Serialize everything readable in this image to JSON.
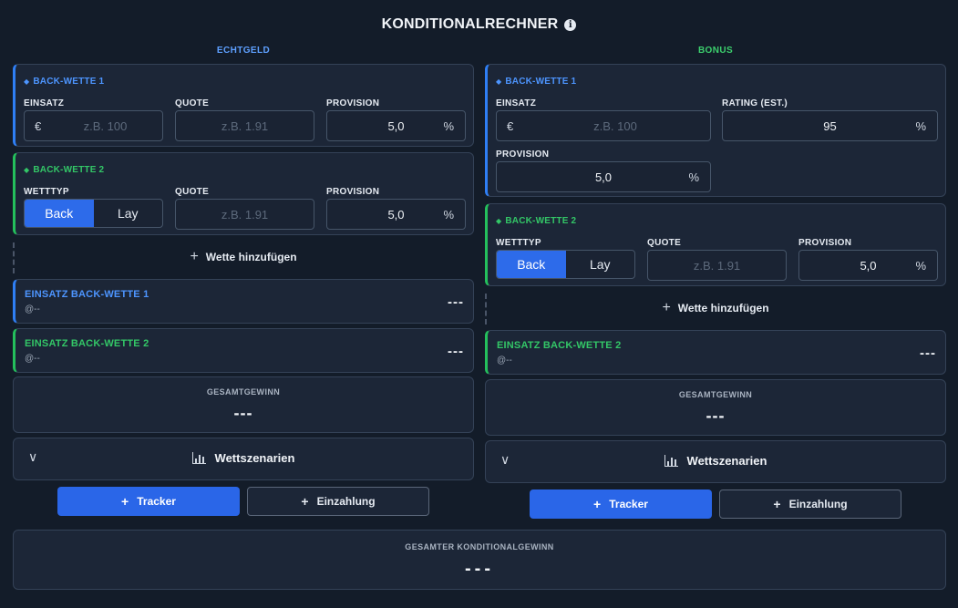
{
  "title": "KONDITIONALRECHNER",
  "info_icon": "info-icon",
  "left": {
    "header": "ECHTGELD",
    "bet1": {
      "title": "BACK-WETTE 1",
      "stake_label": "EINSATZ",
      "stake_prefix": "€",
      "stake_placeholder": "z.B. 100",
      "odds_label": "QUOTE",
      "odds_placeholder": "z.B. 1.91",
      "commission_label": "PROVISION",
      "commission_value": "5,0",
      "commission_suffix": "%"
    },
    "bet2": {
      "title": "BACK-WETTE 2",
      "type_label": "WETTTYP",
      "type_options": [
        "Back",
        "Lay"
      ],
      "type_selected": "Back",
      "odds_label": "QUOTE",
      "odds_placeholder": "z.B. 1.91",
      "commission_label": "PROVISION",
      "commission_value": "5,0",
      "commission_suffix": "%"
    },
    "add_bet": "Wette hinzufügen",
    "stakes": [
      {
        "title": "EINSATZ BACK-WETTE 1",
        "sub": "@--",
        "value": "---"
      },
      {
        "title": "EINSATZ BACK-WETTE 2",
        "sub": "@--",
        "value": "---"
      }
    ],
    "total_label": "GESAMTGEWINN",
    "total_value": "---",
    "scenarios_label": "Wettszenarien",
    "tracker_label": "Tracker",
    "deposit_label": "Einzahlung"
  },
  "right": {
    "header": "BONUS",
    "bet1": {
      "title": "BACK-WETTE 1",
      "stake_label": "EINSATZ",
      "stake_prefix": "€",
      "stake_placeholder": "z.B. 100",
      "rating_label": "RATING (EST.)",
      "rating_value": "95",
      "rating_suffix": "%",
      "commission_label": "PROVISION",
      "commission_value": "5,0",
      "commission_suffix": "%"
    },
    "bet2": {
      "title": "BACK-WETTE 2",
      "type_label": "WETTTYP",
      "type_options": [
        "Back",
        "Lay"
      ],
      "type_selected": "Back",
      "odds_label": "QUOTE",
      "odds_placeholder": "z.B. 1.91",
      "commission_label": "PROVISION",
      "commission_value": "5,0",
      "commission_suffix": "%"
    },
    "add_bet": "Wette hinzufügen",
    "stakes": [
      {
        "title": "EINSATZ BACK-WETTE 2",
        "sub": "@--",
        "value": "---"
      }
    ],
    "total_label": "GESAMTGEWINN",
    "total_value": "---",
    "scenarios_label": "Wettszenarien",
    "tracker_label": "Tracker",
    "deposit_label": "Einzahlung"
  },
  "grand_total_label": "GESAMTER KONDITIONALGEWINN",
  "grand_total_value": "---",
  "colors": {
    "background": "#131c29",
    "card": "#1c2637",
    "accent_blue": "#2f7ff5",
    "accent_green": "#24c05c",
    "primary_button": "#2a66e8"
  }
}
